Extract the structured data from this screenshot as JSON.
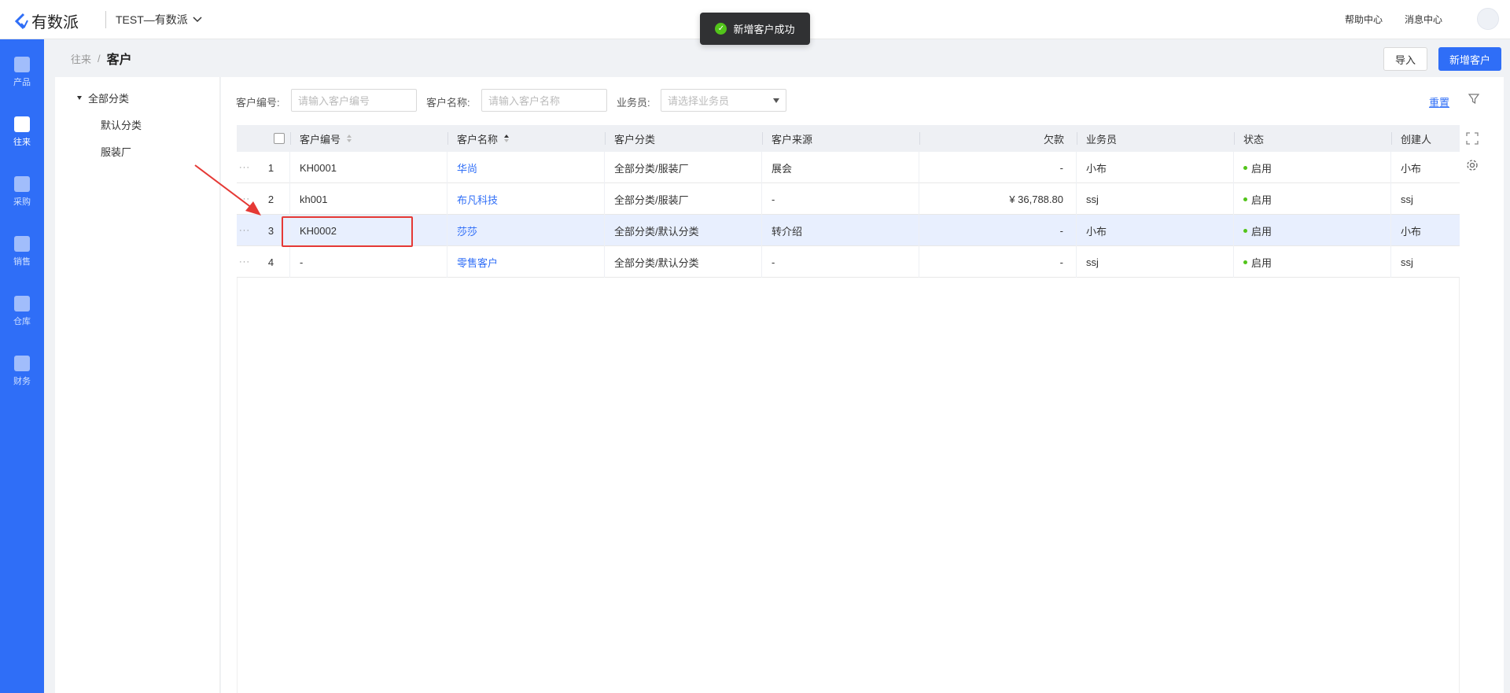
{
  "app": {
    "logo_text": "有数派",
    "tenant": "TEST—有数派"
  },
  "top_links": {
    "help": "帮助中心",
    "messages": "消息中心"
  },
  "toast": {
    "message": "新增客户成功"
  },
  "sidebar": {
    "items": [
      {
        "label": "产品",
        "icon": "product-icon"
      },
      {
        "label": "往来",
        "icon": "contacts-icon"
      },
      {
        "label": "采购",
        "icon": "purchase-icon"
      },
      {
        "label": "销售",
        "icon": "sales-icon"
      },
      {
        "label": "仓库",
        "icon": "warehouse-icon"
      },
      {
        "label": "财务",
        "icon": "finance-icon"
      }
    ],
    "active": "往来"
  },
  "breadcrumb": {
    "parent": "往来",
    "separator": "/",
    "current": "客户"
  },
  "actions": {
    "import_label": "导入",
    "new_label": "新增客户"
  },
  "tree": {
    "root": "全部分类",
    "children": [
      "默认分类",
      "服装厂"
    ]
  },
  "filters": {
    "code_label": "客户编号:",
    "code_placeholder": "请输入客户编号",
    "name_label": "客户名称:",
    "name_placeholder": "请输入客户名称",
    "salesman_label": "业务员:",
    "salesman_placeholder": "请选择业务员",
    "reset_label": "重置"
  },
  "table": {
    "headers": [
      "客户编号",
      "客户名称",
      "客户分类",
      "客户来源",
      "欠款",
      "业务员",
      "状态",
      "创建人"
    ],
    "rows": [
      {
        "index": "1",
        "code": "KH0001",
        "name": "华尚",
        "category": "全部分类/服装厂",
        "source": "展会",
        "debt": "-",
        "salesman": "小布",
        "status": "启用",
        "creator": "小布"
      },
      {
        "index": "2",
        "code": "kh001",
        "name": "布凡科技",
        "category": "全部分类/服装厂",
        "source": "-",
        "debt": "¥ 36,788.80",
        "salesman": "ssj",
        "status": "启用",
        "creator": "ssj"
      },
      {
        "index": "3",
        "code": "KH0002",
        "name": "莎莎",
        "category": "全部分类/默认分类",
        "source": "转介绍",
        "debt": "-",
        "salesman": "小布",
        "status": "启用",
        "creator": "小布"
      },
      {
        "index": "4",
        "code": "-",
        "name": "零售客户",
        "category": "全部分类/默认分类",
        "source": "-",
        "debt": "-",
        "salesman": "ssj",
        "status": "启用",
        "creator": "ssj"
      }
    ],
    "selected_row": "3",
    "more_glyph": "···"
  },
  "colors": {
    "accent": "#2f6ef7",
    "status_green": "#52c41a",
    "highlight_red": "#e53935"
  }
}
